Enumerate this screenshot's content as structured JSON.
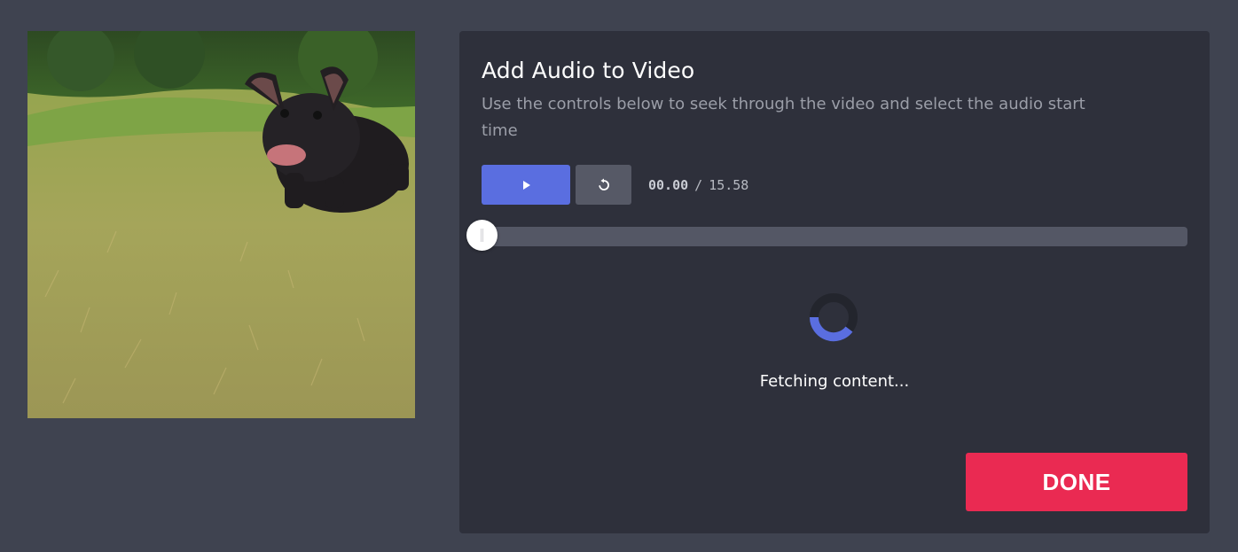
{
  "video": {
    "description": "video-preview-frame"
  },
  "panel": {
    "title": "Add Audio to Video",
    "subtitle": "Use the controls below to seek through the video and select the audio start time"
  },
  "controls": {
    "play_icon": "play-icon",
    "reset_icon": "restart-icon",
    "current_time": "00.00",
    "separator": "/",
    "total_time": "15.58",
    "seek_fraction": 0
  },
  "loading": {
    "text": "Fetching content..."
  },
  "actions": {
    "done_label": "DONE"
  },
  "colors": {
    "background": "#3f4350",
    "panel": "#2e303b",
    "accent": "#5a6ee0",
    "done": "#ea2a52",
    "track": "#545765"
  }
}
